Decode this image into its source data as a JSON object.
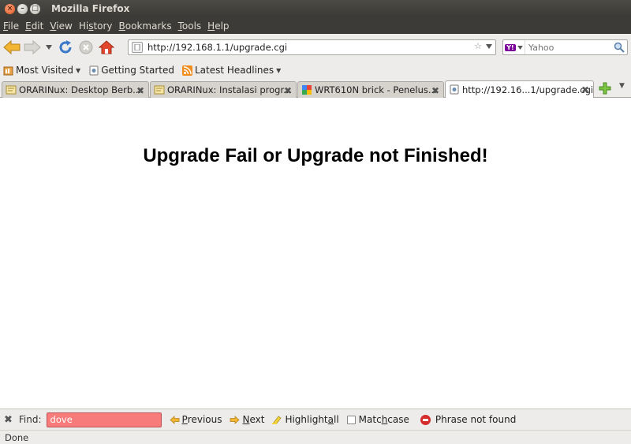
{
  "window": {
    "title": "Mozilla Firefox"
  },
  "menu": [
    {
      "key": "F",
      "rest": "ile"
    },
    {
      "key": "E",
      "rest": "dit"
    },
    {
      "key": "V",
      "rest": "iew"
    },
    {
      "key": "s",
      "pre": "Hi",
      "rest": "tory"
    },
    {
      "key": "B",
      "rest": "ookmarks"
    },
    {
      "key": "T",
      "rest": "ools"
    },
    {
      "key": "H",
      "rest": "elp"
    }
  ],
  "nav": {
    "url": "http://192.168.1.1/upgrade.cgi",
    "search_placeholder": "Yahoo",
    "search_engine": "Y!"
  },
  "bookmarks": [
    {
      "label": "Most Visited",
      "icon": "most-visited-icon",
      "dropdown": true
    },
    {
      "label": "Getting Started",
      "icon": "page-icon",
      "dropdown": false
    },
    {
      "label": "Latest Headlines",
      "icon": "rss-feed-icon",
      "dropdown": true
    }
  ],
  "tabs": [
    {
      "title": "ORARINux: Desktop Berb...",
      "icon": "blogger-favicon-icon",
      "active": false
    },
    {
      "title": "ORARINux: Instalasi progr...",
      "icon": "blogger-favicon-icon",
      "active": false
    },
    {
      "title": "WRT610N brick - Penelus...",
      "icon": "google-favicon-icon",
      "active": false
    },
    {
      "title": "http://192.16...1/upgrade.cgi",
      "icon": "page-icon",
      "active": true
    }
  ],
  "page": {
    "heading": "Upgrade Fail or Upgrade not Finished!"
  },
  "findbar": {
    "label": "Find:",
    "value": "dove",
    "previous_key": "P",
    "previous_rest": "revious",
    "next_key": "N",
    "next_rest": "ext",
    "highlight_pre": "Highlight ",
    "highlight_key": "a",
    "highlight_rest": "ll",
    "match_pre": "Matc",
    "match_key": "h",
    "match_rest": " case",
    "status": "Phrase not found"
  },
  "status": {
    "text": "Done"
  },
  "colors": {
    "titlebar": "#3c3b37",
    "find_error": "#f77b7b",
    "chrome": "#edeceb"
  }
}
